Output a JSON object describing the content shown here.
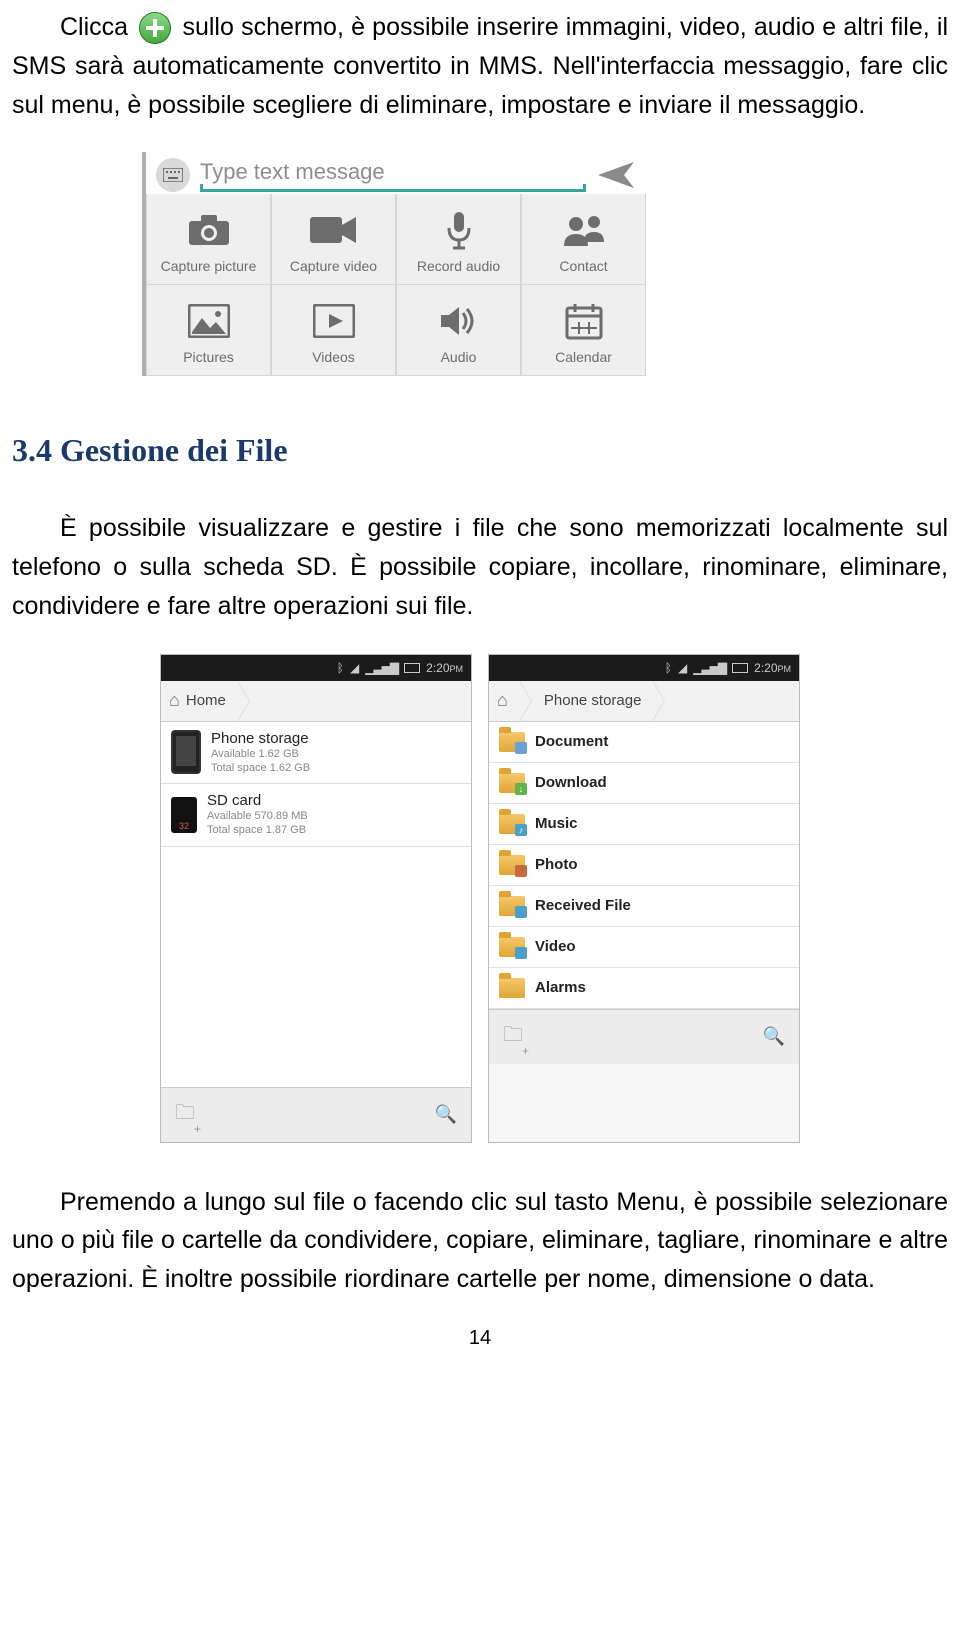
{
  "intro": {
    "clicca": "Clicca",
    "rest": " sullo schermo, è possibile inserire immagini, video, audio e altri file, il SMS sarà automaticamente convertito in MMS. Nell'interfaccia messaggio, fare clic sul menu, è possibile scegliere di eliminare, impostare e inviare il messaggio."
  },
  "msg": {
    "placeholder": "Type text message",
    "items": [
      {
        "label": "Capture picture",
        "icon": "camera"
      },
      {
        "label": "Capture video",
        "icon": "video"
      },
      {
        "label": "Record audio",
        "icon": "mic"
      },
      {
        "label": "Contact",
        "icon": "contact"
      },
      {
        "label": "Pictures",
        "icon": "image"
      },
      {
        "label": "Videos",
        "icon": "play"
      },
      {
        "label": "Audio",
        "icon": "speaker"
      },
      {
        "label": "Calendar",
        "icon": "calendar"
      }
    ]
  },
  "heading": "3.4 Gestione dei File",
  "para2": "È possibile visualizzare e gestire i file che sono memorizzati localmente sul telefono o sulla scheda SD. È possibile copiare, incollare, rinominare, eliminare, condividere e fare altre operazioni sui file.",
  "fm": {
    "time": "2:20",
    "ampm": "PM",
    "left": {
      "crumb": "Home",
      "storage": [
        {
          "name": "Phone storage",
          "avail": "Available 1.62 GB",
          "total": "Total space 1.62 GB",
          "type": "phone"
        },
        {
          "name": "SD card",
          "avail": "Available 570.89 MB",
          "total": "Total space 1.87 GB",
          "type": "sd"
        }
      ]
    },
    "right": {
      "crumb": "Phone storage",
      "folders": [
        {
          "name": "Document",
          "badge": "",
          "color": "#6aa0d8"
        },
        {
          "name": "Download",
          "badge": "↓",
          "color": "#5fb54a"
        },
        {
          "name": "Music",
          "badge": "♪",
          "color": "#4aa0c8"
        },
        {
          "name": "Photo",
          "badge": "",
          "color": "#c96a3a"
        },
        {
          "name": "Received File",
          "badge": "",
          "color": "#4aa0c8"
        },
        {
          "name": "Video",
          "badge": "",
          "color": "#4aa0c8"
        },
        {
          "name": "Alarms",
          "badge": "",
          "color": ""
        }
      ]
    }
  },
  "para3": "Premendo a lungo sul file o facendo clic sul tasto Menu, è possibile selezionare uno o più file o cartelle da condividere, copiare, eliminare, tagliare, rinominare e altre operazioni. È inoltre possibile riordinare cartelle per nome, dimensione o data.",
  "pagenum": "14"
}
